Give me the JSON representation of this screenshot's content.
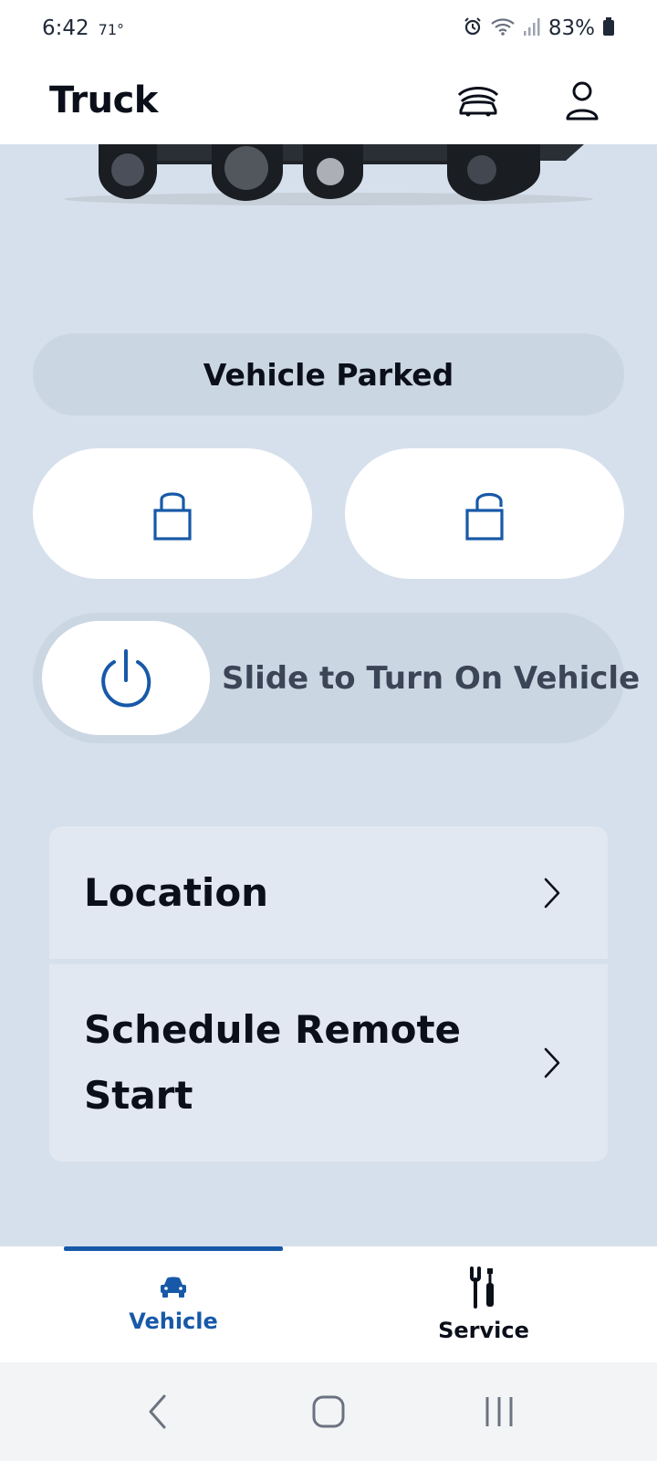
{
  "status_bar": {
    "time": "6:42",
    "temperature": "71°",
    "battery": "83%"
  },
  "header": {
    "title": "Truck"
  },
  "vehicle": {
    "status": "Vehicle Parked",
    "slider_label": "Slide to Turn On Vehicle"
  },
  "menu": {
    "items": [
      {
        "label": "Location"
      },
      {
        "label": "Schedule Remote Start"
      }
    ]
  },
  "bottom_nav": {
    "tabs": [
      {
        "label": "Vehicle",
        "icon": "car-icon",
        "active": true
      },
      {
        "label": "Service",
        "icon": "tools-icon",
        "active": false
      }
    ]
  },
  "colors": {
    "background": "#d6e0ec",
    "accent": "#1759a8",
    "pill": "#cbd6e3",
    "card": "#e2e8f1"
  }
}
